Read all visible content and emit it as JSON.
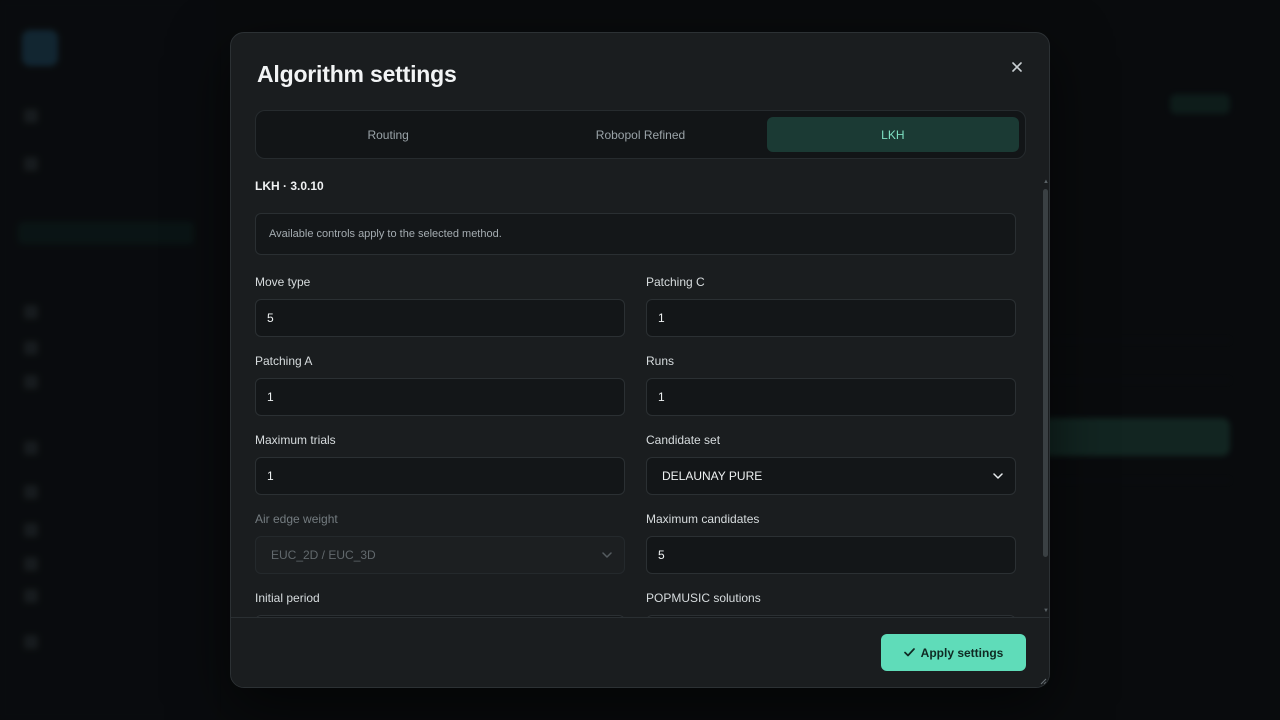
{
  "modal": {
    "title": "Algorithm settings",
    "close_label": "×"
  },
  "tabs": [
    {
      "label": "Routing",
      "active": false
    },
    {
      "label": "Robopol Refined",
      "active": false
    },
    {
      "label": "LKH",
      "active": true
    }
  ],
  "section": {
    "heading": "LKH · 3.0.10",
    "info": "Available controls apply to the selected method."
  },
  "fields": {
    "move_type": {
      "label": "Move type",
      "value": "5"
    },
    "patching_c": {
      "label": "Patching C",
      "value": "1"
    },
    "patching_a": {
      "label": "Patching A",
      "value": "1"
    },
    "runs": {
      "label": "Runs",
      "value": "1"
    },
    "maximum_trials": {
      "label": "Maximum trials",
      "value": "1"
    },
    "candidate_set": {
      "label": "Candidate set",
      "value": "DELAUNAY PURE"
    },
    "air_edge_weight": {
      "label": "Air edge weight",
      "value": "EUC_2D / EUC_3D",
      "disabled": true
    },
    "maximum_candidates": {
      "label": "Maximum candidates",
      "value": "5"
    },
    "initial_period": {
      "label": "Initial period",
      "value": ""
    },
    "popmusic_solutions": {
      "label": "POPMUSIC solutions",
      "value": ""
    }
  },
  "footer": {
    "apply_label": "Apply settings"
  },
  "colors": {
    "accent": "#5fdcb9",
    "tab_active_bg": "#1b3a34",
    "tab_active_text": "#7ee0c2",
    "modal_bg": "#1a1d1f"
  },
  "icons": {
    "close": "close-icon",
    "chevron": "chevron-down-icon",
    "check": "check-icon"
  }
}
